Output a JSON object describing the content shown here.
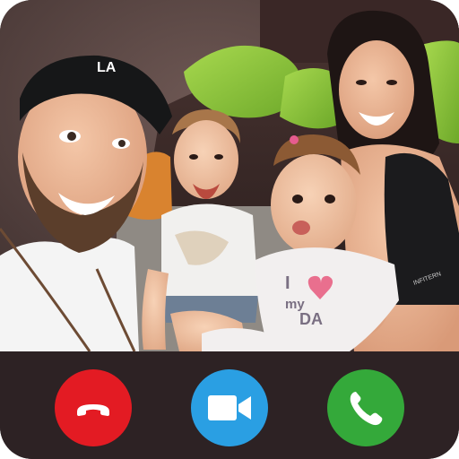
{
  "screen": {
    "name": "incoming-video-call"
  },
  "photo": {
    "shirt_text_line1": "I",
    "shirt_text_line2": "my",
    "shirt_text_line3": "DA",
    "tank_text": "INFITERN",
    "cap_logo": "LA"
  },
  "controls": {
    "end_call": {
      "icon": "phone-hangup-icon",
      "color": "#e31b23"
    },
    "video_call": {
      "icon": "video-camera-icon",
      "color": "#2a9fe3"
    },
    "answer_call": {
      "icon": "phone-icon",
      "color": "#34a93a"
    }
  },
  "colors": {
    "bar_background": "#2d2224",
    "wall": "#5a4644",
    "pillow": "#8cc63f"
  }
}
